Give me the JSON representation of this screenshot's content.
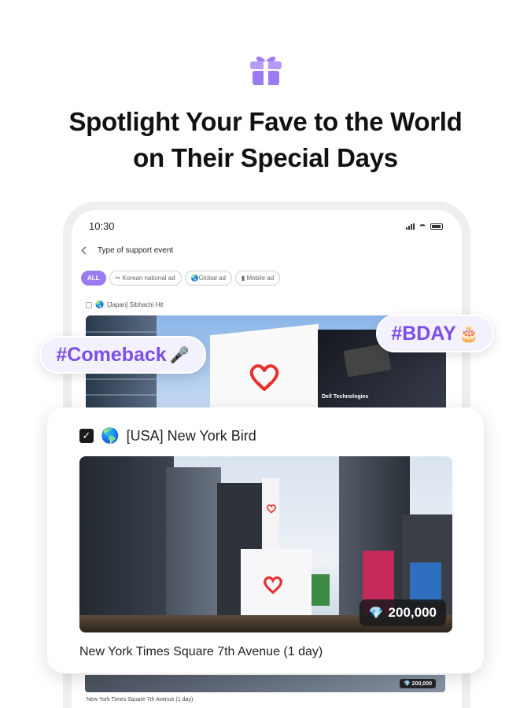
{
  "header": {
    "icon": "gift-icon",
    "line1": "Spotlight Your Fave to the World",
    "line2": "on Their Special Days"
  },
  "phone": {
    "status_time": "10:30",
    "nav_title": "Type of support event",
    "chips": [
      "ALL",
      "Korean national ad",
      "Global ad",
      "Mobile ad"
    ],
    "chip_icons": [
      "",
      "korea-flag-icon",
      "globe-icon",
      "phone-icon"
    ],
    "list_item": "[Japan] Sibhachi Hit",
    "photo_caption": "Dell Technologies"
  },
  "tags": {
    "comeback": "#Comeback",
    "comeback_emoji": "🎤",
    "bday": "#BDAY",
    "bday_emoji": "🎂"
  },
  "card": {
    "checked": true,
    "title": "[USA] New York Bird",
    "globe": "🌎",
    "price": "200,000",
    "caption": "New York Times Square 7th Avenue (1 day)"
  },
  "below": {
    "price": "200,000",
    "caption": "New York Times Square 7th Avenue (1 day)"
  },
  "colors": {
    "accent": "#9b7cf0",
    "tag_text": "#7b4fe6",
    "tag_bg": "#f4f1ff"
  }
}
